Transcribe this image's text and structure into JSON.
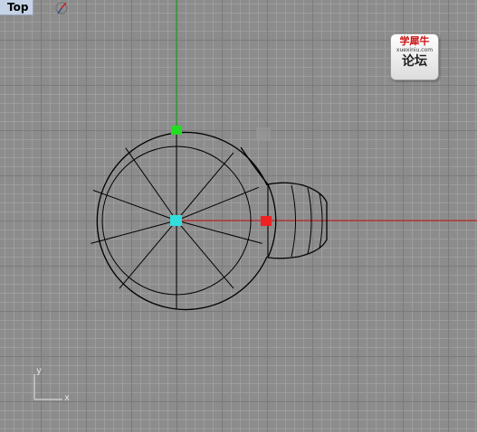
{
  "viewport": {
    "title": "Top"
  },
  "toolbar": {
    "nav_icon": "viewport-navigation-icon"
  },
  "watermark": {
    "line1": "学犀牛",
    "line2": "xuexiniu.com",
    "line3": "论坛"
  },
  "axes_gizmo": {
    "y_label": "y",
    "x_label": "x"
  },
  "colors": {
    "background": "#8c8c8c",
    "grid_minor": "#9d9d9d",
    "grid_major": "#7b7b7b",
    "x_axis": "#cc1010",
    "y_axis": "#10a010",
    "geometry": "#000000",
    "pivot": "#33dddd",
    "y_handle": "#22dd22",
    "x_handle": "#ee2222"
  }
}
